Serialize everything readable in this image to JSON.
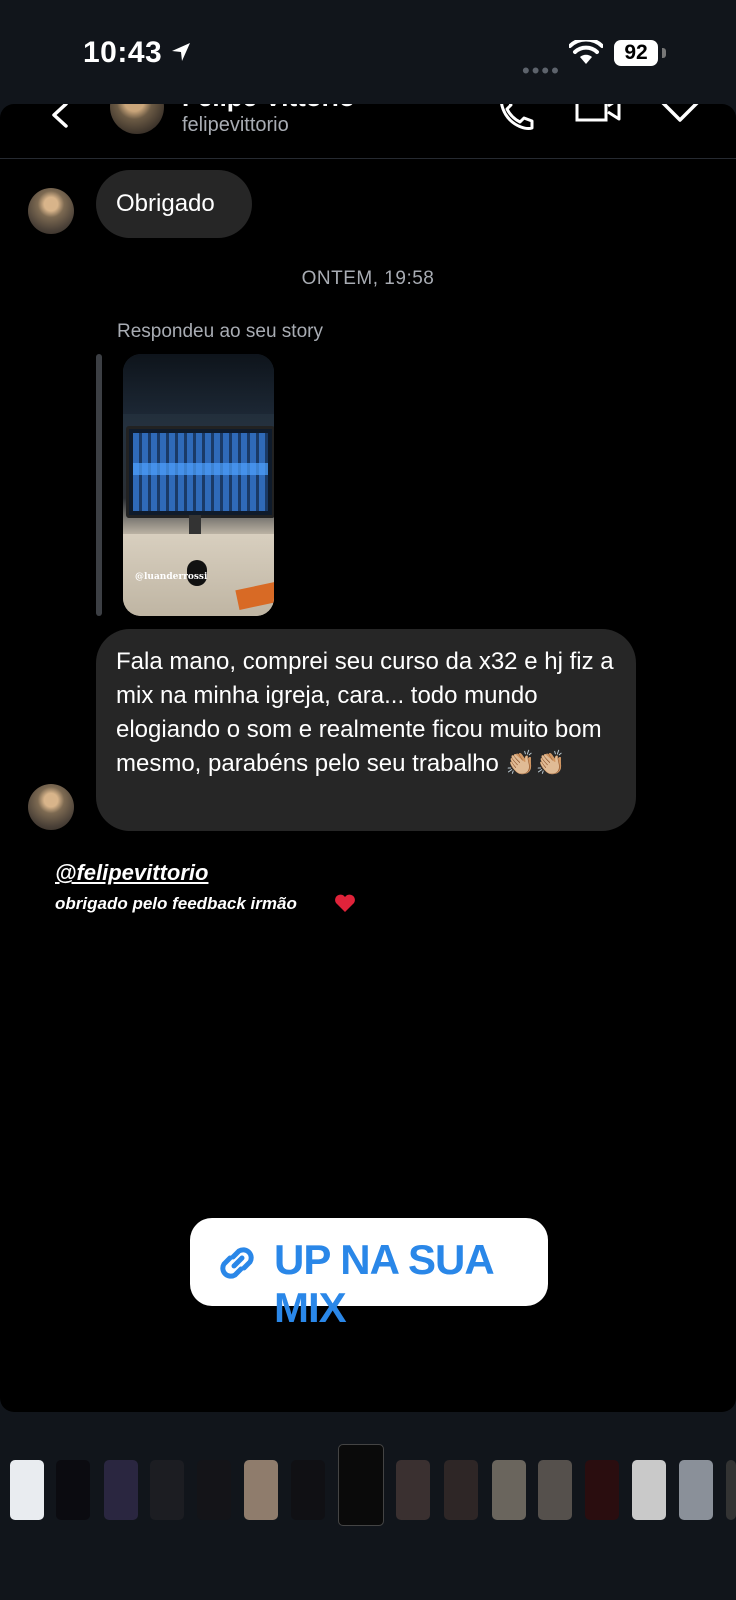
{
  "status_bar": {
    "time": "10:43",
    "battery": "92",
    "signal_dots": "••••"
  },
  "header": {
    "name": "Felipe Vittorio",
    "username": "felipevittorio"
  },
  "chat": {
    "msg1": "Obrigado",
    "timestamp": "ONTEM, 19:58",
    "reply_label": "Respondeu ao seu story",
    "story_credit": "@luanderrossi",
    "msg2": "Fala mano, comprei seu curso da x32 e hj fiz a mix na minha igreja, cara... todo mundo elogiando o som e realmente ficou muito bom mesmo, parabéns pelo seu trabalho 👏🏼👏🏼"
  },
  "overlay": {
    "mention": "@felipevittorio",
    "caption": "obrigado pelo feedback irmão"
  },
  "link_sticker": {
    "label": "UP NA SUA MIX"
  },
  "colors": {
    "bubble": "#262626",
    "link_blue": "#2a87e8",
    "background": "#11151b"
  }
}
